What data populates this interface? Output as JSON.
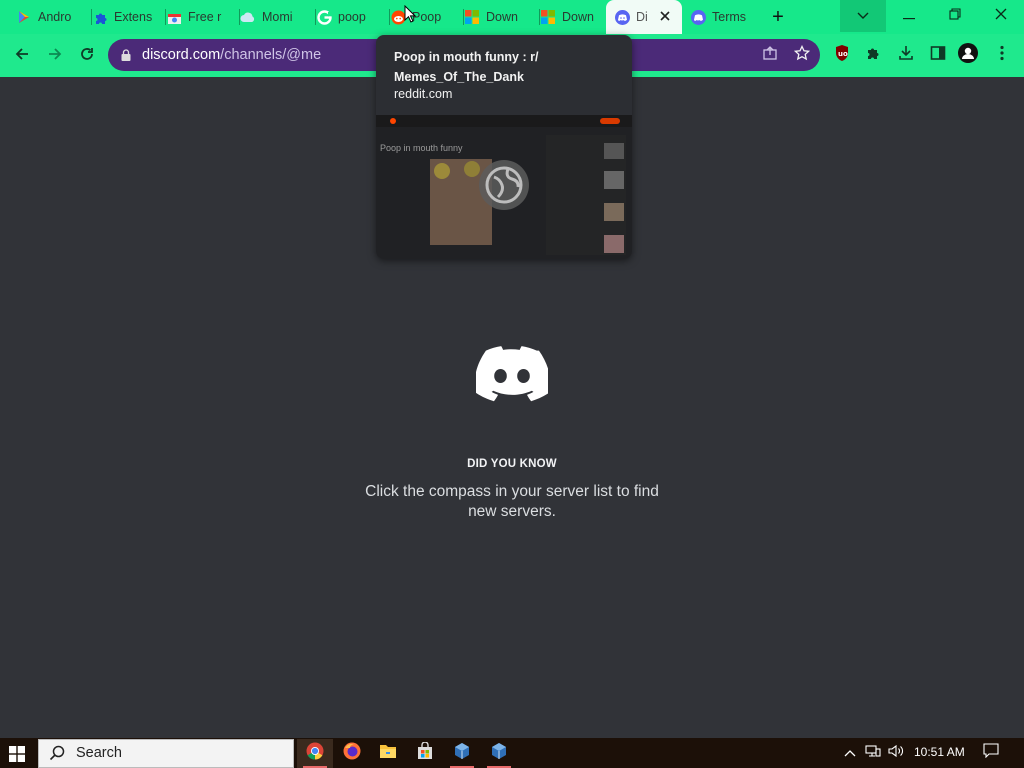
{
  "browser": {
    "tabs": [
      {
        "label": "Andro",
        "icon": "google-play-icon"
      },
      {
        "label": "Extens",
        "icon": "puzzle-icon"
      },
      {
        "label": "Free r",
        "icon": "chrome-store-icon"
      },
      {
        "label": "Momi",
        "icon": "cloud-icon"
      },
      {
        "label": "poop",
        "icon": "google-icon"
      },
      {
        "label": "Poop",
        "icon": "reddit-icon"
      },
      {
        "label": "Down",
        "icon": "microsoft-icon"
      },
      {
        "label": "Down",
        "icon": "microsoft-icon"
      },
      {
        "label": "Di",
        "icon": "discord-icon",
        "active": true
      },
      {
        "label": "Terms",
        "icon": "discord-icon"
      }
    ],
    "new_tab": "+",
    "url_host": "discord.com",
    "url_path": "/channels/@me"
  },
  "hover_card": {
    "title": "Poop in mouth funny : r/ Memes_Of_The_Dank",
    "domain": "reddit.com",
    "thumb_heading": "Poop in mouth funny"
  },
  "discord": {
    "did_you_know": "DID YOU KNOW",
    "tip": "Click the compass in your server list to find new servers."
  },
  "taskbar": {
    "search_placeholder": "Search",
    "time": "10:51 AM"
  },
  "colors": {
    "tab_strip": "#16e88a",
    "toolbar": "#1fe98d",
    "omnibox": "#4b2a78",
    "discord_bg": "#313338",
    "blurple": "#5865f2"
  }
}
